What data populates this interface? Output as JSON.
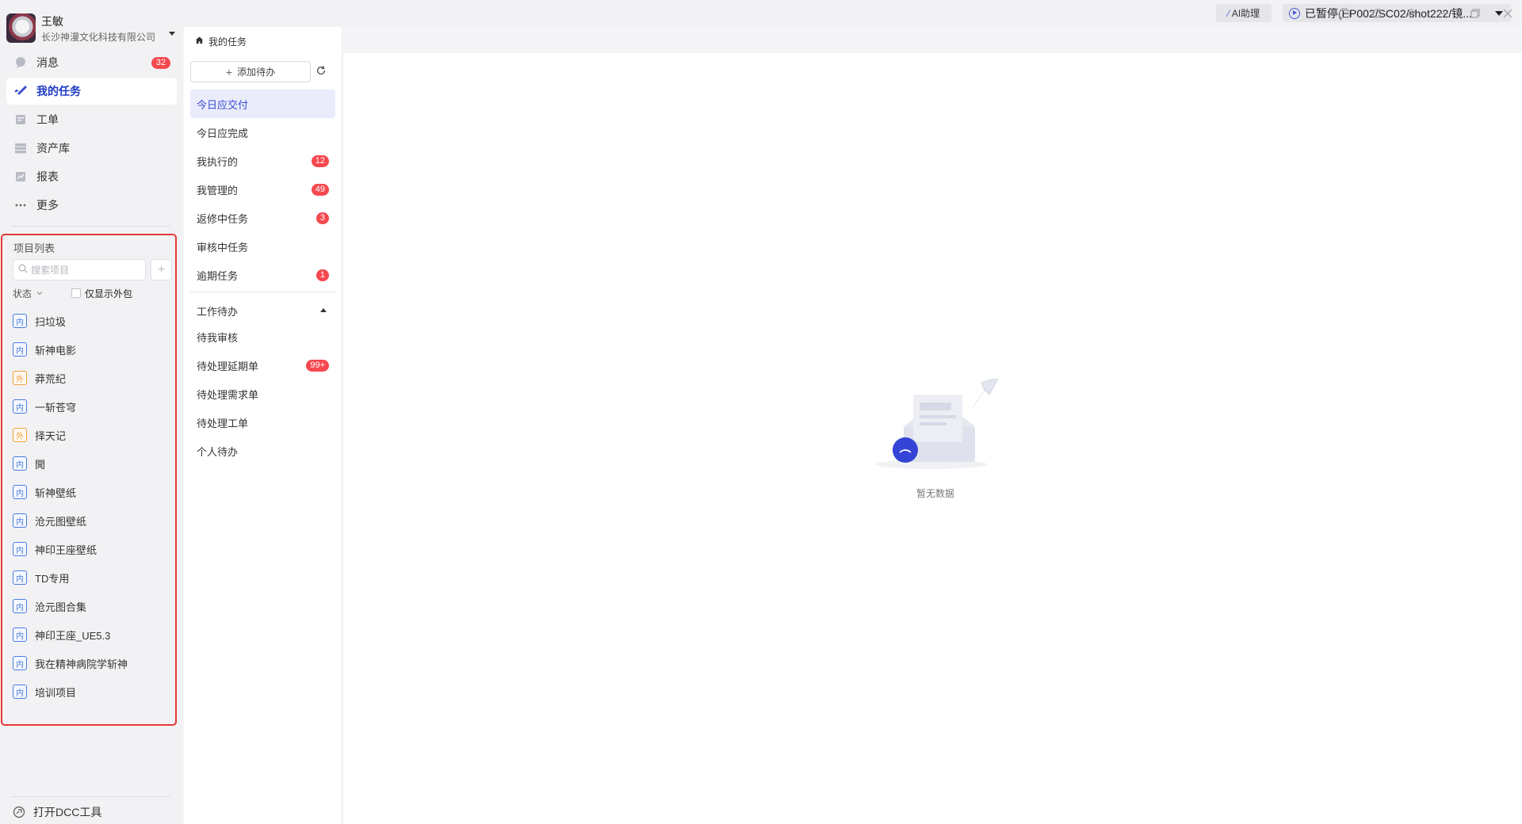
{
  "user": {
    "name": "王敏",
    "company": "长沙神漫文化科技有限公司"
  },
  "nav": [
    {
      "label": "消息",
      "badge": "32",
      "icon": "message-icon"
    },
    {
      "label": "我的任务",
      "badge": "",
      "icon": "task-check-icon",
      "active": true
    },
    {
      "label": "工单",
      "badge": "",
      "icon": "work-order-icon"
    },
    {
      "label": "资产库",
      "badge": "",
      "icon": "asset-library-icon"
    },
    {
      "label": "报表",
      "badge": "",
      "icon": "report-icon"
    },
    {
      "label": "更多",
      "badge": "",
      "icon": "more-icon"
    }
  ],
  "projects": {
    "title": "项目列表",
    "search_placeholder": "搜索项目",
    "filter_status": "状态",
    "filter_outsource_only": "仅显示外包",
    "items": [
      {
        "tag": "内",
        "type": "in",
        "name": "扫垃圾"
      },
      {
        "tag": "内",
        "type": "in",
        "name": "斩神电影"
      },
      {
        "tag": "外",
        "type": "out",
        "name": "莽荒纪"
      },
      {
        "tag": "内",
        "type": "in",
        "name": "一斩苍穹"
      },
      {
        "tag": "外",
        "type": "out",
        "name": "择天记"
      },
      {
        "tag": "内",
        "type": "in",
        "name": "閧"
      },
      {
        "tag": "内",
        "type": "in",
        "name": "斩神壁纸"
      },
      {
        "tag": "内",
        "type": "in",
        "name": "沧元图壁纸"
      },
      {
        "tag": "内",
        "type": "in",
        "name": "神印王座壁纸"
      },
      {
        "tag": "内",
        "type": "in",
        "name": "TD专用"
      },
      {
        "tag": "内",
        "type": "in",
        "name": "沧元图合集"
      },
      {
        "tag": "内",
        "type": "in",
        "name": "神印王座_UE5.3"
      },
      {
        "tag": "内",
        "type": "in",
        "name": "我在精神病院学斩神"
      },
      {
        "tag": "内",
        "type": "in",
        "name": "培训项目"
      }
    ]
  },
  "dcc_label": "打开DCC工具",
  "tab_label": "我的任务",
  "add_todo_label": "添加待办",
  "tasks": [
    {
      "label": "今日应交付",
      "badge": "",
      "active": true
    },
    {
      "label": "今日应完成",
      "badge": ""
    },
    {
      "label": "我执行的",
      "badge": "12"
    },
    {
      "label": "我管理的",
      "badge": "49"
    },
    {
      "label": "返修中任务",
      "badge": "3"
    },
    {
      "label": "审核中任务",
      "badge": ""
    },
    {
      "label": "逾期任务",
      "badge": "1"
    }
  ],
  "work_section": {
    "title": "工作待办",
    "items": [
      {
        "label": "待我审核",
        "badge": ""
      },
      {
        "label": "待处理延期单",
        "badge": "99+"
      },
      {
        "label": "待处理需求单",
        "badge": ""
      },
      {
        "label": "待处理工单",
        "badge": ""
      },
      {
        "label": "个人待办",
        "badge": ""
      }
    ]
  },
  "empty_text": "暂无数据",
  "topbar": {
    "ai_label": "AI助理",
    "status_label": "已暂停(EP002/SC02/shot222/镜..."
  },
  "colors": {
    "accent": "#3b4fd0",
    "badge": "#f5484f",
    "highlight_border": "#e53935"
  }
}
